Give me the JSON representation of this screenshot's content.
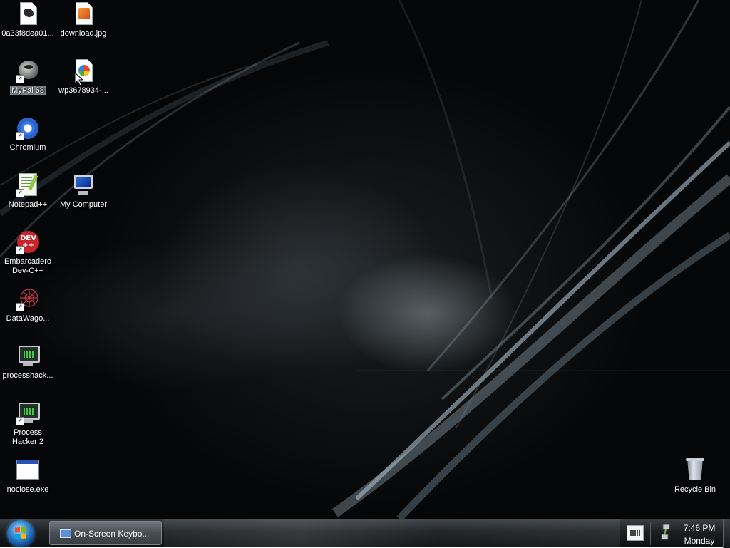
{
  "desktop": {
    "icons": [
      {
        "id": "0a33",
        "label": "0a33f8dea01...",
        "icon": "image-file-icon"
      },
      {
        "id": "download",
        "label": "download.jpg",
        "icon": "jpg-file-icon"
      },
      {
        "id": "mypal",
        "label": "MyPal 68",
        "icon": "mypal-browser-icon"
      },
      {
        "id": "wp",
        "label": "wp3678934-...",
        "icon": "jpg-file-icon"
      },
      {
        "id": "chromium",
        "label": "Chromium",
        "icon": "chromium-icon"
      },
      {
        "id": "notepadpp",
        "label": "Notepad++",
        "icon": "notepadpp-icon"
      },
      {
        "id": "mycomputer",
        "label": "My Computer",
        "icon": "computer-icon"
      },
      {
        "id": "devcpp",
        "label": "Embarcadero\nDev-C++",
        "icon": "devcpp-icon",
        "badge": "DEV\n++"
      },
      {
        "id": "datawagon",
        "label": "DataWago...",
        "icon": "datawagon-icon"
      },
      {
        "id": "processhack",
        "label": "processhack...",
        "icon": "process-hacker-icon"
      },
      {
        "id": "processhacker2",
        "label": "Process\nHacker 2",
        "icon": "process-hacker-icon"
      },
      {
        "id": "noclose",
        "label": "noclose.exe",
        "icon": "exe-window-icon"
      },
      {
        "id": "recyclebin",
        "label": "Recycle Bin",
        "icon": "recycle-bin-icon"
      }
    ],
    "selected": "MyPal 68"
  },
  "taskbar": {
    "start_icon": "windows-start-orb-icon",
    "tasks": [
      {
        "label": "On-Screen Keybo...",
        "icon": "keyboard-icon"
      }
    ],
    "tray": {
      "icons": [
        "on-screen-keyboard-icon",
        "network-icon"
      ],
      "time": "7:46 PM",
      "day": "Monday"
    }
  },
  "colors": {
    "taskbar": "#1c1f22",
    "selection": "#7c8590",
    "accent": "#3a8fd8"
  }
}
